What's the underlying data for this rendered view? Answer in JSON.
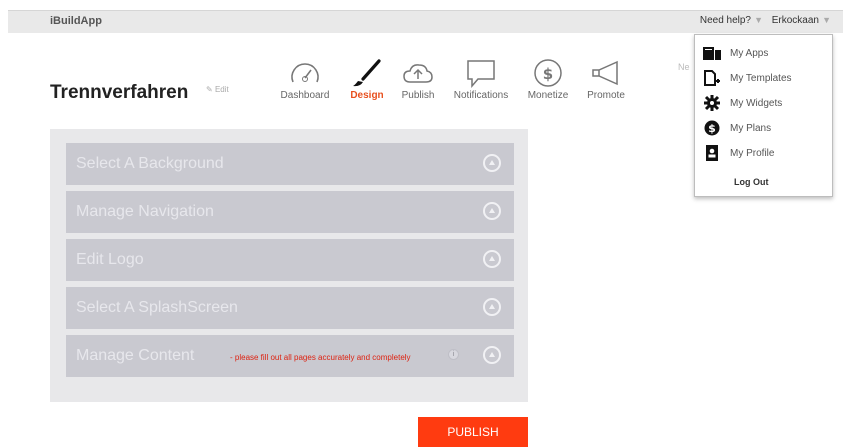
{
  "header": {
    "brand": "iBuildApp",
    "help": "Need help?",
    "user": "Erkockaan",
    "caret": "▼"
  },
  "app": {
    "title": "Trennverfahren",
    "edit": "Edit",
    "partial_label": "Ne"
  },
  "nav": [
    {
      "label": "Dashboard",
      "icon": "gauge-icon"
    },
    {
      "label": "Design",
      "icon": "brush-icon",
      "active": true
    },
    {
      "label": "Publish",
      "icon": "cloud-upload-icon"
    },
    {
      "label": "Notifications",
      "icon": "chat-icon"
    },
    {
      "label": "Monetize",
      "icon": "dollar-icon"
    },
    {
      "label": "Promote",
      "icon": "megaphone-icon"
    }
  ],
  "sections": [
    {
      "label": "Select A Background"
    },
    {
      "label": "Manage Navigation"
    },
    {
      "label": "Edit Logo"
    },
    {
      "label": "Select A SplashScreen"
    },
    {
      "label": "Manage Content",
      "note": "- please fill out all pages accurately and completely",
      "info": "i"
    }
  ],
  "publish_button": "PUBLISH",
  "user_menu": [
    {
      "label": "My Apps",
      "icon": "apps-icon"
    },
    {
      "label": "My Templates",
      "icon": "template-icon"
    },
    {
      "label": "My Widgets",
      "icon": "gear-icon"
    },
    {
      "label": "My Plans",
      "icon": "dollar-icon"
    },
    {
      "label": "My Profile",
      "icon": "profile-icon"
    }
  ],
  "logout": "Log Out",
  "colors": {
    "accent": "#e8501f",
    "publish": "#ff3b10",
    "row": "#c9c9d0"
  }
}
